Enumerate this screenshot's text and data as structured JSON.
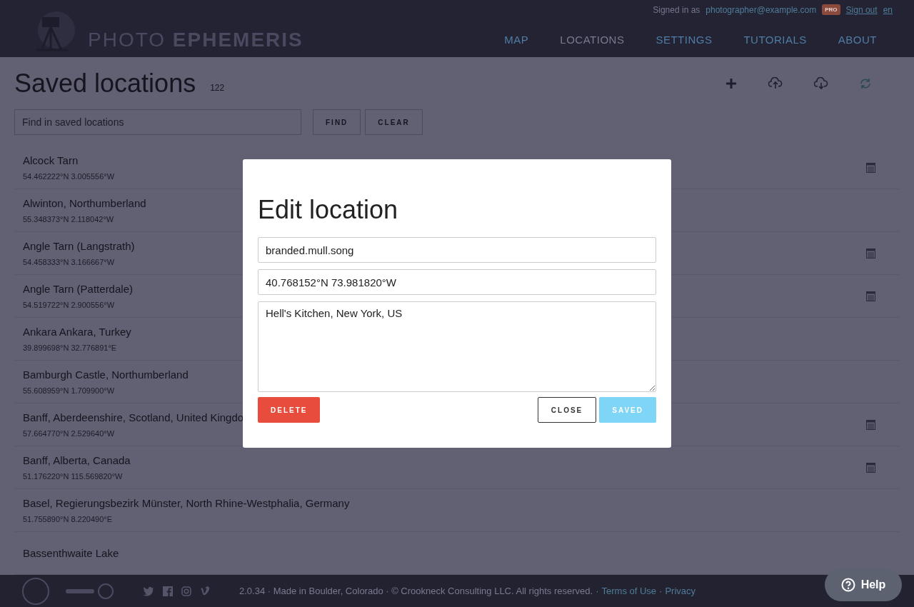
{
  "header": {
    "logo_light": "PHOTO",
    "logo_bold": "EPHEMERIS",
    "signed_in_label": "Signed in as",
    "email": "photographer@example.com",
    "badge": "PRO",
    "sign_out": "Sign out",
    "language": "en",
    "nav": [
      {
        "label": "MAP",
        "selected": false
      },
      {
        "label": "LOCATIONS",
        "selected": true
      },
      {
        "label": "SETTINGS",
        "selected": false
      },
      {
        "label": "TUTORIALS",
        "selected": false
      },
      {
        "label": "ABOUT",
        "selected": false
      }
    ]
  },
  "page": {
    "title": "Saved locations",
    "count": "122",
    "search": {
      "placeholder": "Find in saved locations"
    },
    "find_button": "FIND",
    "clear_button": "CLEAR",
    "locations": [
      {
        "name": "Alcock Tarn",
        "coords": "54.462222°N 3.005556°W",
        "calendar": true
      },
      {
        "name": "Alwinton, Northumberland",
        "coords": "55.348373°N 2.118042°W",
        "calendar": false
      },
      {
        "name": "Angle Tarn (Langstrath)",
        "coords": "54.458333°N 3.166667°W",
        "calendar": true
      },
      {
        "name": "Angle Tarn (Patterdale)",
        "coords": "54.519722°N 2.900556°W",
        "calendar": true
      },
      {
        "name": "Ankara Ankara, Turkey",
        "coords": "39.899698°N 32.776891°E",
        "calendar": false
      },
      {
        "name": "Bamburgh Castle, Northumberland",
        "coords": "55.608959°N 1.709900°W",
        "calendar": false
      },
      {
        "name": "Banff, Aberdeenshire, Scotland, United Kingdo",
        "coords": "57.664770°N 2.529640°W",
        "calendar": true
      },
      {
        "name": "Banff, Alberta, Canada",
        "coords": "51.176220°N 115.569820°W",
        "calendar": true
      },
      {
        "name": "Basel, Regierungsbezirk Münster, North Rhine-Westphalia, Germany",
        "coords": "51.755890°N 8.220490°E",
        "calendar": false
      },
      {
        "name": "Bassenthwaite Lake",
        "calendar": false
      }
    ]
  },
  "dialog": {
    "title": "Edit location",
    "name_value": "branded.mull.song",
    "coords_value": "40.768152°N 73.981820°W",
    "description_value": "Hell's Kitchen, New York, US",
    "delete_button": "DELETE",
    "close_button": "CLOSE",
    "saved_button": "SAVED",
    "saved_disabled": true
  },
  "footer": {
    "text": "2.0.34 · Made in Boulder, Colorado · © Crookneck Consulting LLC. All rights reserved.",
    "sep1": "·",
    "terms_link": "Terms of Use",
    "sep2": "·",
    "privacy_link": "Privacy"
  },
  "help_button": "Help"
}
